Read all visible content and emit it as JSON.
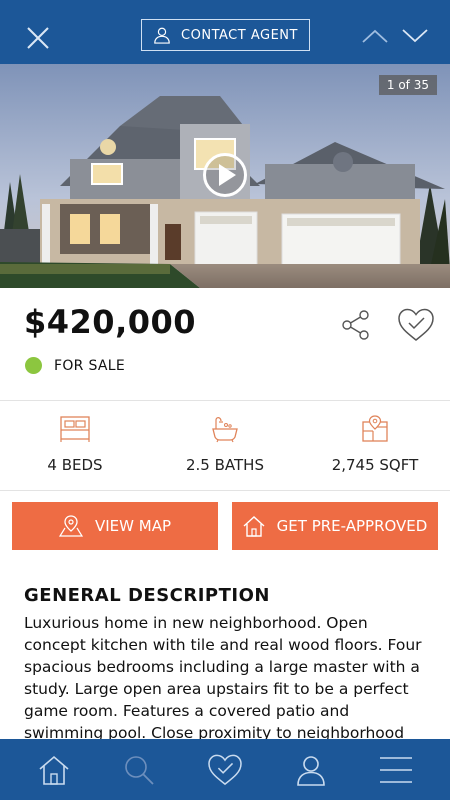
{
  "header": {
    "contact_agent_label": "CONTACT AGENT"
  },
  "gallery": {
    "counter": "1 of 35"
  },
  "listing": {
    "price": "$420,000",
    "status": "FOR SALE",
    "status_color": "#8cc63f"
  },
  "stats": {
    "beds": "4 BEDS",
    "baths": "2.5 BATHS",
    "sqft": "2,745 SQFT"
  },
  "actions": {
    "view_map": "VIEW MAP",
    "pre_approved": "GET PRE-APPROVED"
  },
  "description": {
    "title": "GENERAL DESCRIPTION",
    "body": "Luxurious home in new neighborhood. Open concept kitchen with tile and real wood floors. Four spacious bedrooms including a large master with a study. Large open area upstairs fit to be a perfect game room. Features a covered patio and swimming pool. Close proximity to neighborhood"
  },
  "icons": {
    "close": "close-icon",
    "contact": "user-icon",
    "prev": "chevron-up-icon",
    "next": "chevron-down-icon",
    "play": "play-icon",
    "share": "share-icon",
    "favorite": "heart-icon",
    "beds": "bed-icon",
    "baths": "bathtub-icon",
    "sqft": "floorplan-icon",
    "map": "map-marker-icon",
    "home": "home-icon",
    "nav_home": "home-icon",
    "nav_search": "search-icon",
    "nav_favorites": "heart-check-icon",
    "nav_profile": "user-icon",
    "nav_menu": "menu-icon"
  },
  "colors": {
    "brand_blue": "#1c5798",
    "accent_orange": "#ee6c44",
    "icon_orange": "#e0845a",
    "status_green": "#8cc63f"
  }
}
